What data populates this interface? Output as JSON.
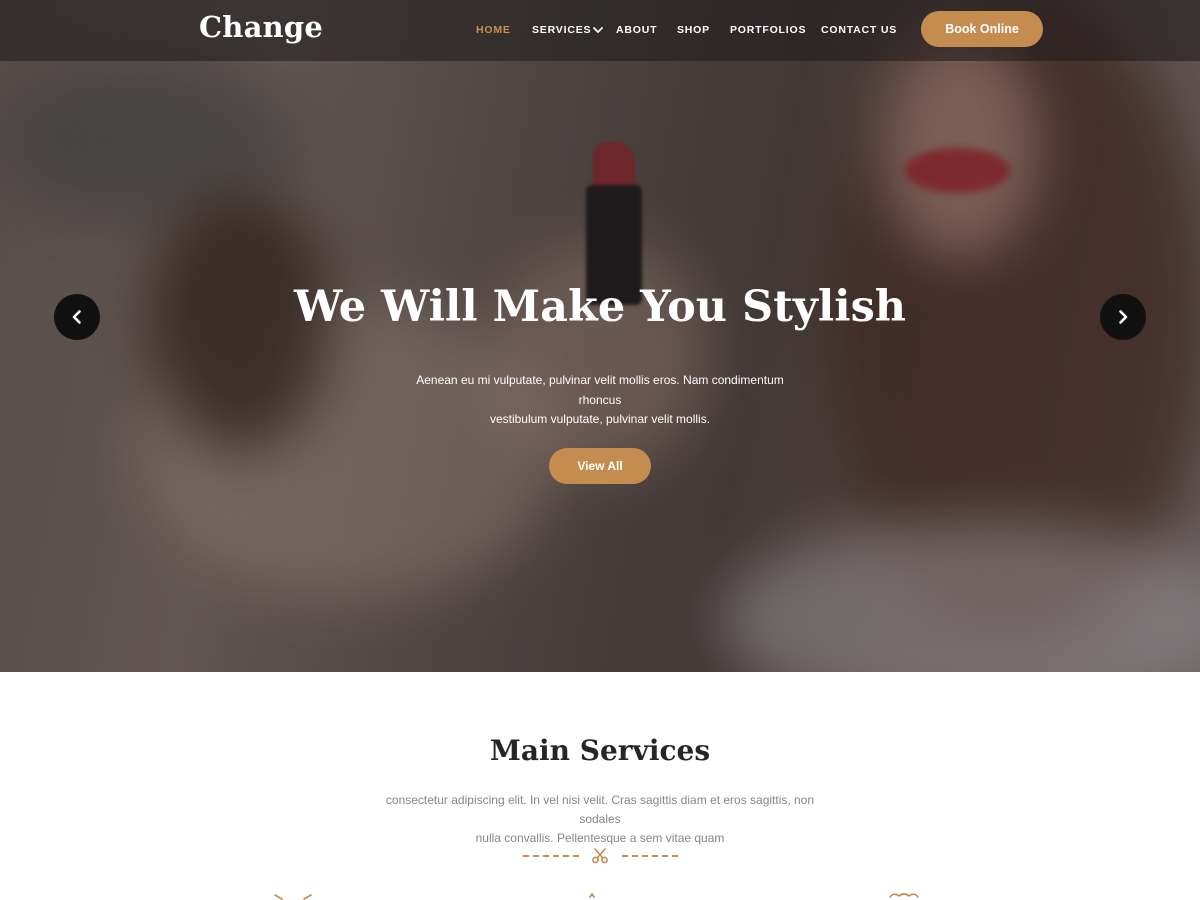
{
  "brand": {
    "logo": "Change"
  },
  "nav": {
    "items": [
      {
        "label": "HOME",
        "active": true
      },
      {
        "label": "SERVICES",
        "active": false
      },
      {
        "label": "ABOUT",
        "active": false
      },
      {
        "label": "SHOP",
        "active": false
      },
      {
        "label": "PORTFOLIOS",
        "active": false
      },
      {
        "label": "CONTACT US",
        "active": false
      }
    ],
    "book_label": "Book Online"
  },
  "hero": {
    "title": "We Will Make You Stylish",
    "desc_line1": "Aenean eu mi vulputate, pulvinar velit mollis eros. Nam condimentum rhoncus",
    "desc_line2": "vestibulum vulputate, pulvinar velit mollis.",
    "button_label": "View All",
    "prev_icon": "chevron-left-icon",
    "next_icon": "chevron-right-icon"
  },
  "services": {
    "title": "Main Services",
    "desc_line1": "consectetur adipiscing elit. In vel nisi velit. Cras sagittis diam et eros sagittis, non sodales",
    "desc_line2": "nulla convallis. Pellentesque a sem vitae quam",
    "divider_icon": "scissors-icon"
  },
  "colors": {
    "accent": "#c48d4f",
    "nav_active": "#c8924d",
    "heading": "#2a2525",
    "body_text": "#8a8484"
  }
}
